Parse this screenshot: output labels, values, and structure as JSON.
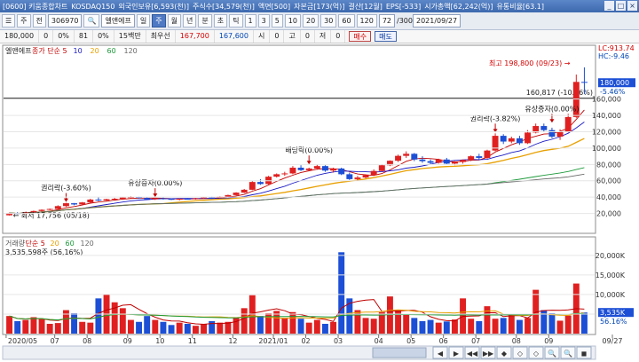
{
  "window": {
    "title_parts": [
      "[0600] 키움종합차트",
      "KOSDAQ150",
      "외국인보유[6,593(천)]",
      "주식수[34,579(천)]",
      "액면[500]",
      "자본금[173(억)]",
      "결산[12월]",
      "EPS[-533]",
      "시가총액[62,242(억)]",
      "유통비율[63.1]"
    ],
    "controls": [
      "_",
      "□",
      "×"
    ]
  },
  "toolbar": {
    "menu_icon": "☰",
    "chart_type": "주",
    "period_prefix": "전",
    "code": "306970",
    "search_icon": "🔍",
    "stock_name": "엘앤에프",
    "period_buttons": [
      "일",
      "주",
      "월",
      "년",
      "분",
      "초",
      "틱"
    ],
    "active_period": "주",
    "minute_buttons": [
      "1",
      "3",
      "5",
      "10",
      "20",
      "30",
      "60",
      "120"
    ],
    "count_value": "72",
    "count_max": "/300",
    "date": "2021/09/27"
  },
  "quote": {
    "price": "180,000",
    "change": "0",
    "change_rate": "0%",
    "volume": "81",
    "volume_rate": "0%",
    "limit_label": "15백만",
    "best_label": "최우선",
    "ask": "167,700",
    "bid": "167,600",
    "open_label": "시",
    "open": "0",
    "high_label": "고",
    "high": "0",
    "low_label": "저",
    "low": "0",
    "buy": "매수",
    "sell": "매도"
  },
  "chart_data": [
    {
      "type": "candlestick",
      "name": "엘앤에프",
      "legend": [
        "엘앤에프",
        "종가 단순 5",
        "10",
        "20",
        "60",
        "120"
      ],
      "ma_colors": [
        "#c00000",
        "#1a1ac4",
        "#e8a000",
        "#1d9a3a",
        "#6a6a6a"
      ],
      "ylim": [
        0,
        215000
      ],
      "yticks": [
        "20,000",
        "40,000",
        "60,000",
        "80,000",
        "100,000",
        "120,000",
        "140,000",
        "160,000"
      ],
      "xticks": [
        "2020/05",
        "07",
        "08",
        "09",
        "10",
        "11",
        "12",
        "2021/01",
        "02",
        "03",
        "04",
        "05",
        "06",
        "07",
        "08",
        "09",
        "09/27"
      ],
      "ohlc": [
        [
          17756,
          21000,
          17500,
          20500
        ],
        [
          20500,
          21500,
          19000,
          19500
        ],
        [
          19500,
          22000,
          19000,
          21500
        ],
        [
          21500,
          23500,
          21000,
          23000
        ],
        [
          23000,
          25000,
          22000,
          24500
        ],
        [
          24500,
          26000,
          24000,
          25500
        ],
        [
          25500,
          30000,
          25000,
          29000
        ],
        [
          29000,
          33000,
          28000,
          32500
        ],
        [
          32500,
          32800,
          30000,
          31000
        ],
        [
          31000,
          34000,
          30500,
          33500
        ],
        [
          33500,
          38000,
          33000,
          37000
        ],
        [
          37000,
          40000,
          35000,
          36000
        ],
        [
          36000,
          38000,
          35000,
          37500
        ],
        [
          37500,
          39000,
          36500,
          38000
        ],
        [
          38000,
          40000,
          37000,
          39500
        ],
        [
          39500,
          41000,
          38500,
          40000
        ],
        [
          40000,
          40500,
          38000,
          39000
        ],
        [
          39000,
          40000,
          37000,
          37500
        ],
        [
          37500,
          39000,
          36500,
          38500
        ],
        [
          38500,
          39500,
          37000,
          37800
        ],
        [
          37800,
          38500,
          36500,
          37000
        ],
        [
          37000,
          38500,
          36000,
          38000
        ],
        [
          38000,
          39000,
          37000,
          37800
        ],
        [
          37800,
          39000,
          37000,
          38600
        ],
        [
          38600,
          40000,
          38000,
          39500
        ],
        [
          39500,
          40500,
          38500,
          39000
        ],
        [
          39000,
          41000,
          38500,
          40500
        ],
        [
          40500,
          43000,
          40000,
          42500
        ],
        [
          42500,
          46000,
          42000,
          45500
        ],
        [
          45500,
          50000,
          45000,
          49000
        ],
        [
          49000,
          60000,
          48500,
          58500
        ],
        [
          58500,
          62000,
          55000,
          56000
        ],
        [
          56000,
          66000,
          55500,
          65000
        ],
        [
          65000,
          69000,
          64000,
          68000
        ],
        [
          68000,
          71000,
          66000,
          69000
        ],
        [
          69000,
          78000,
          68000,
          76000
        ],
        [
          76000,
          79000,
          72000,
          73000
        ],
        [
          73000,
          76000,
          72000,
          75000
        ],
        [
          75000,
          80000,
          73500,
          78000
        ],
        [
          78000,
          79000,
          71000,
          72500
        ],
        [
          72500,
          76000,
          70000,
          75000
        ],
        [
          75000,
          76000,
          67000,
          68000
        ],
        [
          68000,
          70000,
          61000,
          62000
        ],
        [
          62000,
          66000,
          60000,
          64000
        ],
        [
          64000,
          68000,
          63000,
          67000
        ],
        [
          67000,
          74000,
          66000,
          72000
        ],
        [
          72000,
          80000,
          71500,
          79000
        ],
        [
          79000,
          85000,
          78000,
          84500
        ],
        [
          84500,
          92000,
          83000,
          90500
        ],
        [
          90500,
          96000,
          88000,
          93000
        ],
        [
          93000,
          94000,
          84000,
          86000
        ],
        [
          86000,
          90000,
          82000,
          84000
        ],
        [
          84000,
          86000,
          80000,
          82000
        ],
        [
          82000,
          87000,
          81000,
          86000
        ],
        [
          86000,
          88000,
          80000,
          81000
        ],
        [
          81000,
          84000,
          79000,
          83000
        ],
        [
          83000,
          86000,
          81000,
          85500
        ],
        [
          85500,
          91000,
          84000,
          90000
        ],
        [
          90000,
          93000,
          86000,
          88000
        ],
        [
          88000,
          98000,
          87000,
          97000
        ],
        [
          97000,
          118000,
          96000,
          115000
        ],
        [
          115000,
          117000,
          105000,
          108000
        ],
        [
          108000,
          114000,
          106000,
          112000
        ],
        [
          112000,
          115000,
          104000,
          106000
        ],
        [
          106000,
          122000,
          105000,
          119000
        ],
        [
          119000,
          130000,
          118000,
          127000
        ],
        [
          127000,
          130000,
          120000,
          122000
        ],
        [
          122000,
          125000,
          112000,
          114000
        ],
        [
          114000,
          123000,
          110000,
          120500
        ],
        [
          120500,
          142000,
          119000,
          138000
        ],
        [
          138000,
          190000,
          137000,
          181000
        ],
        [
          181000,
          198800,
          166000,
          180000
        ]
      ],
      "annotations": [
        {
          "text": "최저 17,756 (05/18)",
          "index": 0,
          "value": 17756
        },
        {
          "text": "권리락(-3.60%)",
          "index": 7,
          "value": 33000
        },
        {
          "text": "유상증자(0.00%)",
          "index": 18,
          "value": 39000
        },
        {
          "text": "배당락(0.00%)",
          "index": 37,
          "value": 79000
        },
        {
          "text": "권리락(-3.82%)",
          "index": 60,
          "value": 118000
        },
        {
          "text": "유상증자(0.00%)",
          "index": 67,
          "value": 130000
        },
        {
          "text": "최고 198,800 (09/23)",
          "index": 71,
          "value": 198800
        }
      ],
      "horizontal_line": {
        "value": 160817,
        "label": "160,817 (-10.66%)"
      },
      "right_labels": {
        "top": "LC:913.74",
        "top2": "HC:-9.46",
        "price": "180,000",
        "rate": "-5.46%"
      }
    },
    {
      "type": "bar",
      "name": "거래량",
      "legend": [
        "거래량",
        "단순 5",
        "20",
        "60",
        "120"
      ],
      "current": "3,535,598주 (56,16%)",
      "ylim": [
        0,
        22000000
      ],
      "yticks": [
        "5,000K",
        "10,000K",
        "15,000K",
        "20,000K"
      ],
      "right_labels": {
        "value": "3,535K",
        "rate": "56.16%"
      },
      "values": [
        4500000,
        3200000,
        3500000,
        4200000,
        3800000,
        2500000,
        2700000,
        6000000,
        5200000,
        3000000,
        2800000,
        9000000,
        10000000,
        8000000,
        6500000,
        3500000,
        3000000,
        4500000,
        3500000,
        3000000,
        2200000,
        2800000,
        2500000,
        2000000,
        2400000,
        3200000,
        2800000,
        3000000,
        4000000,
        6500000,
        9800000,
        4500000,
        5200000,
        5800000,
        4000000,
        5500000,
        3800000,
        2800000,
        3500000,
        2500000,
        3000000,
        20800000,
        9000000,
        6000000,
        4000000,
        3800000,
        5500000,
        9500000,
        6000000,
        4800000,
        4000000,
        3200000,
        3500000,
        2800000,
        3100000,
        3600000,
        9000000,
        3800000,
        3200000,
        7000000,
        3800000,
        4000000,
        4800000,
        3500000,
        4000000,
        11200000,
        6000000,
        5200000,
        3300000,
        4600000,
        12800000,
        5400000
      ]
    }
  ],
  "bottom_controls": [
    "◀",
    "▶",
    "◀◀",
    "▶▶",
    "◆",
    "◇",
    "◇",
    "🔍",
    "🔍",
    "◼"
  ]
}
